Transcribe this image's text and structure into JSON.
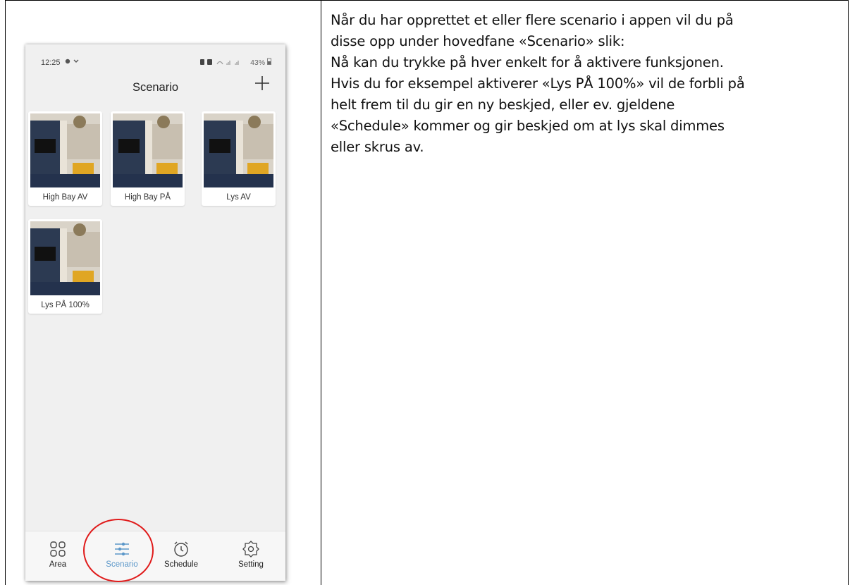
{
  "status_bar": {
    "time": "12:25",
    "battery": "43%"
  },
  "header": {
    "title": "Scenario",
    "add_icon": "plus-icon"
  },
  "scenarios": [
    {
      "label": "High Bay AV"
    },
    {
      "label": "High Bay PÅ"
    },
    {
      "label": "Lys AV"
    },
    {
      "label": "Lys PÅ 100%"
    }
  ],
  "tabbar": {
    "tabs": [
      {
        "label": "Area",
        "icon": "grid-icon"
      },
      {
        "label": "Scenario",
        "icon": "sliders-icon",
        "active": true
      },
      {
        "label": "Schedule",
        "icon": "alarm-clock-icon"
      },
      {
        "label": "Setting",
        "icon": "gear-icon"
      }
    ]
  },
  "highlight_color": "#e01b1b",
  "accent_color": "#5b97c9",
  "document": {
    "lines": [
      "Når du har opprettet et eller flere scenario i appen vil du på",
      "disse opp under hovedfane «Scenario» slik:",
      "Nå kan du trykke på hver enkelt for å aktivere funksjonen.",
      "Hvis du for eksempel aktiverer «Lys PÅ 100%» vil de forbli på",
      "helt frem til du gir en ny beskjed, eller ev. gjeldene",
      "«Schedule» kommer og gir beskjed om at lys skal dimmes",
      "eller skrus av."
    ]
  }
}
